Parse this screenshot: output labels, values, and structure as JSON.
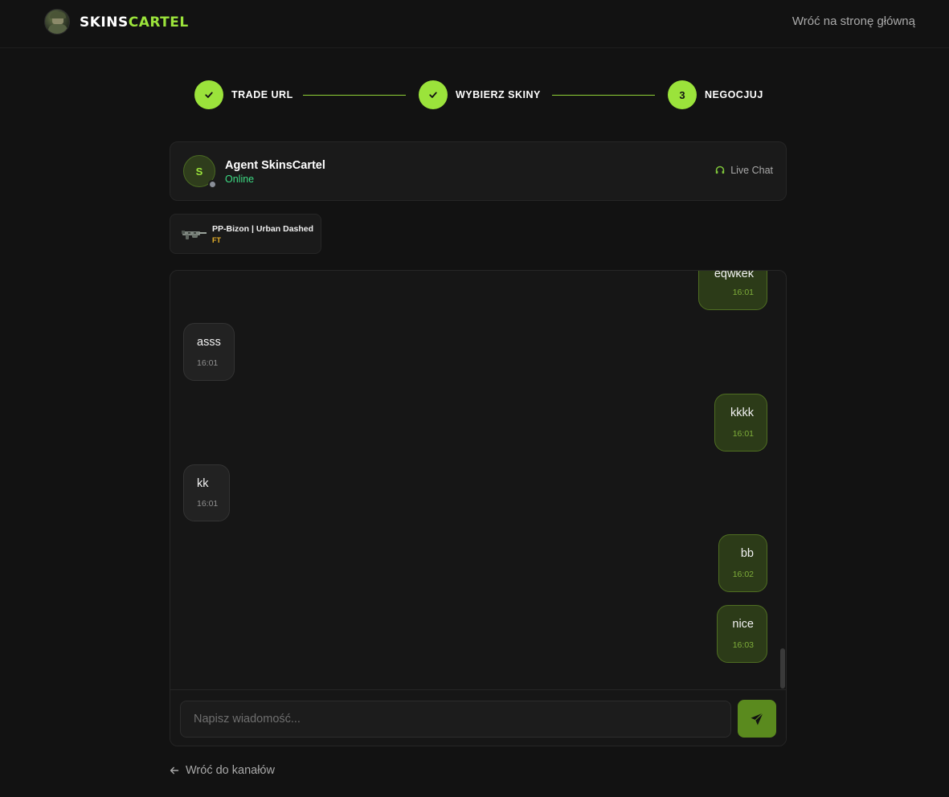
{
  "header": {
    "logo_part1": "SKINS",
    "logo_part2": "CARTEL",
    "home_link": "Wróć na stronę główną"
  },
  "stepper": {
    "steps": [
      {
        "label": "TRADE URL",
        "state": "done"
      },
      {
        "label": "WYBIERZ SKINY",
        "state": "done"
      },
      {
        "label": "NEGOCJUJ",
        "state": "active",
        "number": "3"
      }
    ]
  },
  "agent": {
    "initial": "S",
    "name": "Agent SkinsCartel",
    "status": "Online",
    "live_chat": "Live Chat"
  },
  "item": {
    "name": "PP-Bizon | Urban Dashed",
    "wear": "FT"
  },
  "messages": [
    {
      "side": "out",
      "text": "eqwkek",
      "time": "16:01"
    },
    {
      "side": "in",
      "text": "asss",
      "time": "16:01"
    },
    {
      "side": "out",
      "text": "kkkk",
      "time": "16:01"
    },
    {
      "side": "in",
      "text": "kk",
      "time": "16:01"
    },
    {
      "side": "out",
      "text": "bb",
      "time": "16:02"
    },
    {
      "side": "out",
      "text": "nice",
      "time": "16:03"
    }
  ],
  "composer": {
    "placeholder": "Napisz wiadomość..."
  },
  "footer": {
    "back_link": "Wróć do kanałów"
  },
  "colors": {
    "accent": "#9be33b",
    "online": "#3ddc84",
    "wear": "#e8b12a",
    "background": "#121212"
  }
}
